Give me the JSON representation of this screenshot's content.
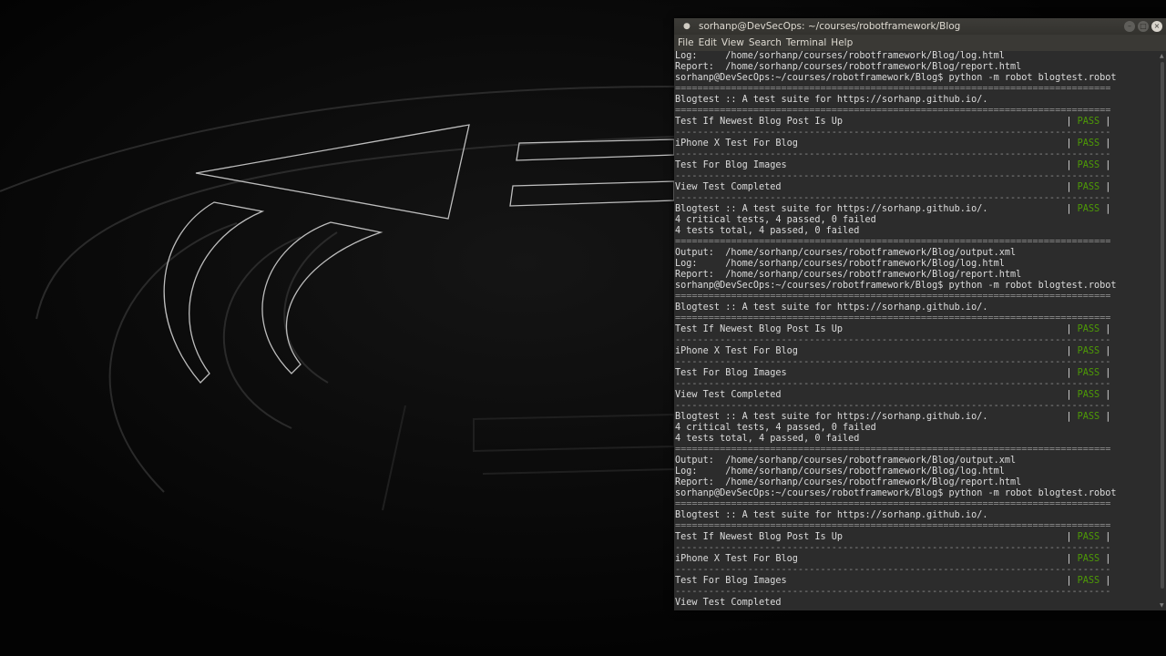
{
  "window": {
    "title": "sorhanp@DevSecOps: ~/courses/robotframework/Blog",
    "controls": {
      "minimize": "–",
      "maximize": "□",
      "close": "×"
    }
  },
  "menu": [
    "File",
    "Edit",
    "View",
    "Search",
    "Terminal",
    "Help"
  ],
  "terminal": {
    "lines": [
      {
        "pre": "Log:     /home/sorhanp/courses/robotframework/Blog/log.html"
      },
      {
        "pre": "Report:  /home/sorhanp/courses/robotframework/Blog/report.html"
      },
      {
        "pre": "sorhanp@DevSecOps:~/courses/robotframework/Blog$ python -m robot blogtest.robot"
      },
      {
        "pre": "==============================================================================",
        "dim": true
      },
      {
        "pre": "Blogtest :: A test suite for https://sorhanp.github.io/."
      },
      {
        "pre": "==============================================================================",
        "dim": true
      },
      {
        "pre": "Test If Newest Blog Post Is Up                                        | ",
        "status": "PASS",
        "post": " |"
      },
      {
        "pre": "------------------------------------------------------------------------------",
        "dim": true
      },
      {
        "pre": "iPhone X Test For Blog                                                | ",
        "status": "PASS",
        "post": " |"
      },
      {
        "pre": "------------------------------------------------------------------------------",
        "dim": true
      },
      {
        "pre": "Test For Blog Images                                                  | ",
        "status": "PASS",
        "post": " |"
      },
      {
        "pre": "------------------------------------------------------------------------------",
        "dim": true
      },
      {
        "pre": "View Test Completed                                                   | ",
        "status": "PASS",
        "post": " |"
      },
      {
        "pre": "------------------------------------------------------------------------------",
        "dim": true
      },
      {
        "pre": "Blogtest :: A test suite for https://sorhanp.github.io/.              | ",
        "status": "PASS",
        "post": " |"
      },
      {
        "pre": "4 critical tests, 4 passed, 0 failed"
      },
      {
        "pre": "4 tests total, 4 passed, 0 failed"
      },
      {
        "pre": "==============================================================================",
        "dim": true
      },
      {
        "pre": "Output:  /home/sorhanp/courses/robotframework/Blog/output.xml"
      },
      {
        "pre": "Log:     /home/sorhanp/courses/robotframework/Blog/log.html"
      },
      {
        "pre": "Report:  /home/sorhanp/courses/robotframework/Blog/report.html"
      },
      {
        "pre": "sorhanp@DevSecOps:~/courses/robotframework/Blog$ python -m robot blogtest.robot"
      },
      {
        "pre": "==============================================================================",
        "dim": true
      },
      {
        "pre": "Blogtest :: A test suite for https://sorhanp.github.io/."
      },
      {
        "pre": "==============================================================================",
        "dim": true
      },
      {
        "pre": "Test If Newest Blog Post Is Up                                        | ",
        "status": "PASS",
        "post": " |"
      },
      {
        "pre": "------------------------------------------------------------------------------",
        "dim": true
      },
      {
        "pre": "iPhone X Test For Blog                                                | ",
        "status": "PASS",
        "post": " |"
      },
      {
        "pre": "------------------------------------------------------------------------------",
        "dim": true
      },
      {
        "pre": "Test For Blog Images                                                  | ",
        "status": "PASS",
        "post": " |"
      },
      {
        "pre": "------------------------------------------------------------------------------",
        "dim": true
      },
      {
        "pre": "View Test Completed                                                   | ",
        "status": "PASS",
        "post": " |"
      },
      {
        "pre": "------------------------------------------------------------------------------",
        "dim": true
      },
      {
        "pre": "Blogtest :: A test suite for https://sorhanp.github.io/.              | ",
        "status": "PASS",
        "post": " |"
      },
      {
        "pre": "4 critical tests, 4 passed, 0 failed"
      },
      {
        "pre": "4 tests total, 4 passed, 0 failed"
      },
      {
        "pre": "==============================================================================",
        "dim": true
      },
      {
        "pre": "Output:  /home/sorhanp/courses/robotframework/Blog/output.xml"
      },
      {
        "pre": "Log:     /home/sorhanp/courses/robotframework/Blog/log.html"
      },
      {
        "pre": "Report:  /home/sorhanp/courses/robotframework/Blog/report.html"
      },
      {
        "pre": "sorhanp@DevSecOps:~/courses/robotframework/Blog$ python -m robot blogtest.robot"
      },
      {
        "pre": "==============================================================================",
        "dim": true
      },
      {
        "pre": "Blogtest :: A test suite for https://sorhanp.github.io/."
      },
      {
        "pre": "==============================================================================",
        "dim": true
      },
      {
        "pre": "Test If Newest Blog Post Is Up                                        | ",
        "status": "PASS",
        "post": " |"
      },
      {
        "pre": "------------------------------------------------------------------------------",
        "dim": true
      },
      {
        "pre": "iPhone X Test For Blog                                                | ",
        "status": "PASS",
        "post": " |"
      },
      {
        "pre": "------------------------------------------------------------------------------",
        "dim": true
      },
      {
        "pre": "Test For Blog Images                                                  | ",
        "status": "PASS",
        "post": " |"
      },
      {
        "pre": "------------------------------------------------------------------------------",
        "dim": true
      },
      {
        "pre": "View Test Completed"
      }
    ]
  },
  "colors": {
    "pass": "#4e9a06",
    "terminal_bg": "#2c2c2c",
    "terminal_fg": "#dcdcdc",
    "desktop_bg": "#050505"
  }
}
